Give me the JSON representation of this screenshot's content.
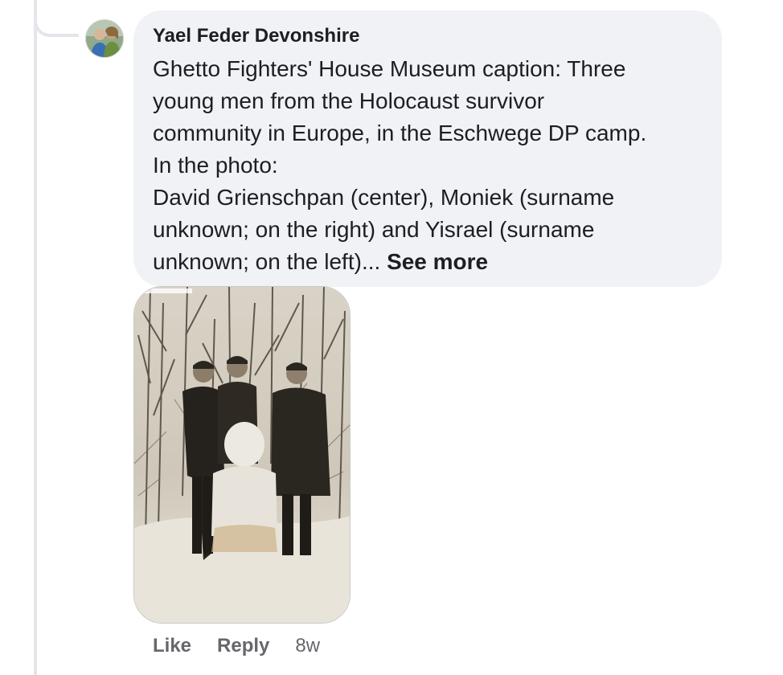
{
  "comment": {
    "author": "Yael Feder Devonshire",
    "text": "Ghetto Fighters' House Museum caption: Three\nyoung men from the Holocaust survivor\ncommunity in Europe, in the Eschwege DP camp.\nIn the photo:\nDavid Grienschpan (center), Moniek (surname\nunknown; on the right) and Yisrael (surname\nunknown; on the left)...",
    "see_more": "See more",
    "avatar_icon": "profile-photo-avatar",
    "photo_icon": "sepia-photo-three-men-snowman"
  },
  "actions": {
    "like": "Like",
    "reply": "Reply",
    "timestamp": "8w"
  },
  "colors": {
    "bubble": "#f0f2f5",
    "text": "#1c1e21",
    "secondary": "#65676b",
    "thread_line": "#e4e6eb"
  }
}
